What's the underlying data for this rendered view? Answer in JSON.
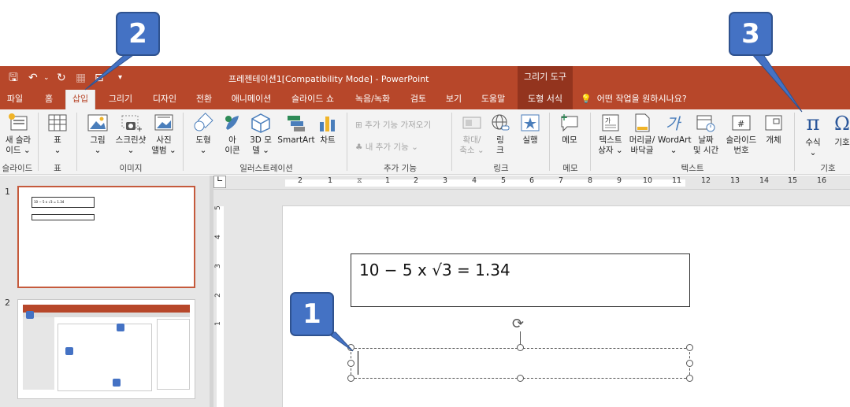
{
  "window": {
    "title": "프레젠테이션1[Compatibility Mode]  -  PowerPoint",
    "context_tools": "그리기 도구"
  },
  "tabs": [
    "파일",
    "홈",
    "삽입",
    "그리기",
    "디자인",
    "전환",
    "애니메이션",
    "슬라이드 쇼",
    "녹음/녹화",
    "검토",
    "보기",
    "도움말",
    "도형 서식"
  ],
  "active_tab": "삽입",
  "tell_me": "어떤 작업을 원하시나요?",
  "ribbon": {
    "new_slide": "새 슬라\n이드 ⌄",
    "table": "표\n⌄",
    "picture": "그림\n⌄",
    "screenshot": "스크린샷\n⌄",
    "album": "사진\n앨범 ⌄",
    "shapes": "도형\n⌄",
    "icons": "아\n이콘",
    "model3d": "3D 모\n델 ⌄",
    "smartart": "SmartArt",
    "chart": "차트",
    "get_addins": "추가 기능 가져오기",
    "my_addins": "내 추가 기능",
    "zoom": "확대/\n축소 ⌄",
    "link": "링\n크",
    "action": "실행",
    "comment": "메모",
    "textbox": "텍스트\n상자 ⌄",
    "header_footer": "머리글/\n바닥글",
    "wordart": "WordArt\n⌄",
    "datetime": "날짜\n및 시간",
    "slide_number": "슬라이드\n번호",
    "object": "개체",
    "equation": "수식\n⌄",
    "symbol": "기호",
    "groups": {
      "slides": "슬라이드",
      "tables": "표",
      "images": "이미지",
      "illustrations": "일러스트레이션",
      "addins": "추가 기능",
      "links": "링크",
      "comments": "메모",
      "text": "텍스트",
      "symbols": "기호"
    }
  },
  "thumbnails": [
    {
      "number": "1",
      "equation": "10 − 5 x √3 = 1.34"
    },
    {
      "number": "2"
    }
  ],
  "ruler": {
    "h": [
      "2",
      "1",
      "1",
      "2",
      "3",
      "4",
      "5",
      "6",
      "7",
      "8",
      "9",
      "10",
      "11",
      "12",
      "13",
      "14",
      "15",
      "16"
    ],
    "v": [
      "5",
      "4",
      "3",
      "2",
      "1"
    ]
  },
  "slide": {
    "equation": "10 − 5 x √3  =  1.34"
  },
  "callouts": [
    "1",
    "2",
    "3"
  ],
  "colors": {
    "accent": "#b7472a",
    "context": "#93341e",
    "callout": "#4472c4"
  }
}
